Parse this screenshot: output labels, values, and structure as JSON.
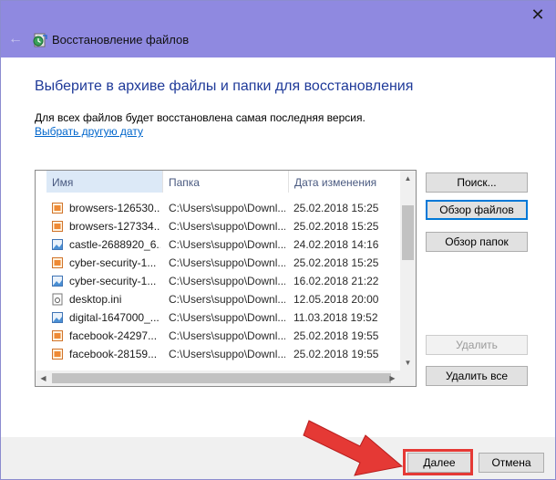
{
  "window": {
    "title": "Восстановление файлов",
    "close_glyph": "✕",
    "back_glyph": "←",
    "title_bar_color": "#8f89e0"
  },
  "content": {
    "heading": "Выберите в архиве файлы и папки для восстановления",
    "info": "Для всех файлов будет восстановлена самая последняя версия.",
    "choose_date_link": "Выбрать другую дату"
  },
  "file_list": {
    "columns": [
      "Имя",
      "Папка",
      "Дата изменения"
    ],
    "rows": [
      {
        "name": "browsers-126530...",
        "path": "C:\\Users\\suppo\\Downl...",
        "date": "25.02.2018 15:25",
        "icon": "image-icon"
      },
      {
        "name": "browsers-127334...",
        "path": "C:\\Users\\suppo\\Downl...",
        "date": "25.02.2018 15:25",
        "icon": "image-icon"
      },
      {
        "name": "castle-2688920_6...",
        "path": "C:\\Users\\suppo\\Downl...",
        "date": "24.02.2018 14:16",
        "icon": "photo-icon"
      },
      {
        "name": "cyber-security-1...",
        "path": "C:\\Users\\suppo\\Downl...",
        "date": "25.02.2018 15:25",
        "icon": "image-icon"
      },
      {
        "name": "cyber-security-1...",
        "path": "C:\\Users\\suppo\\Downl...",
        "date": "16.02.2018 21:22",
        "icon": "photo-icon"
      },
      {
        "name": "desktop.ini",
        "path": "C:\\Users\\suppo\\Downl...",
        "date": "12.05.2018 20:00",
        "icon": "settings-file-icon"
      },
      {
        "name": "digital-1647000_...",
        "path": "C:\\Users\\suppo\\Downl...",
        "date": "11.03.2018 19:52",
        "icon": "photo-icon"
      },
      {
        "name": "facebook-24297...",
        "path": "C:\\Users\\suppo\\Downl...",
        "date": "25.02.2018 19:55",
        "icon": "image-icon"
      },
      {
        "name": "facebook-28159...",
        "path": "C:\\Users\\suppo\\Downl...",
        "date": "25.02.2018 19:55",
        "icon": "image-icon"
      }
    ]
  },
  "side_buttons": {
    "search": "Поиск...",
    "browse_files": "Обзор файлов",
    "browse_folders": "Обзор папок",
    "remove": "Удалить",
    "remove_all": "Удалить все"
  },
  "footer": {
    "next": "Далее",
    "cancel": "Отмена",
    "highlight_color": "#e53935"
  }
}
